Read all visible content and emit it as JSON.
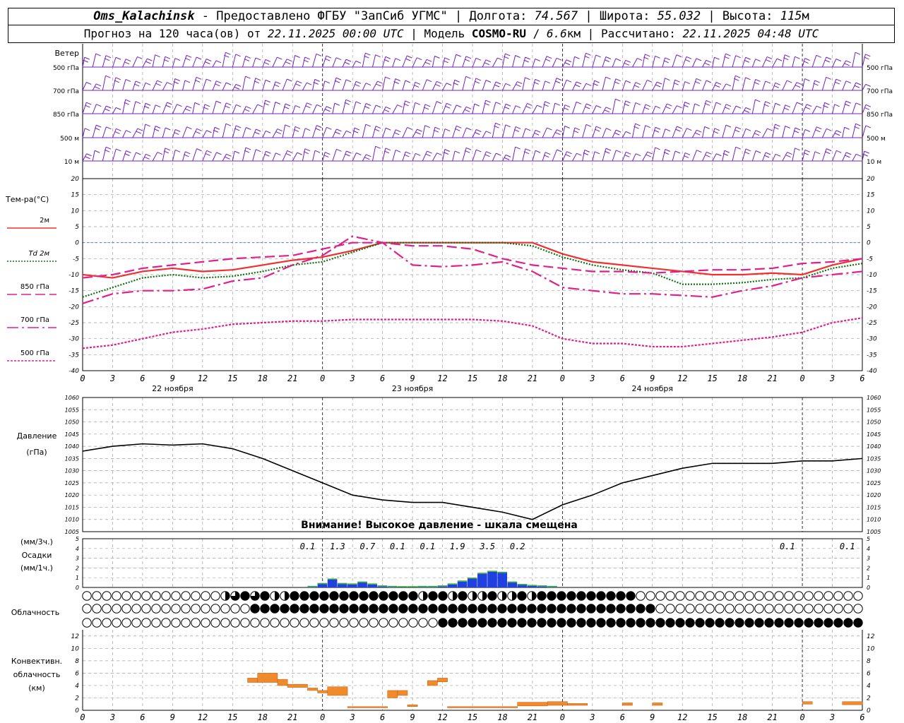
{
  "header": {
    "station": "Oms_Kalachinsk",
    "provider": "Предоставлено ФГБУ \"ЗапСиб УГМС\"",
    "lon_label": "Долгота:",
    "lon_value": "74.567",
    "lat_label": "Широта:",
    "lat_value": "55.032",
    "alt_label": "Высота:",
    "alt_value": "115",
    "alt_unit": "м",
    "forecast_prefix": "Прогноз на 120 часа(ов) от",
    "forecast_start": "22.11.2025 00:00 UTC",
    "model_label": "Модель",
    "model_name": "COSMO-RU",
    "model_res": "6.6",
    "model_unit": "км",
    "calc_label": "Рассчитано:",
    "calc_time": "22.11.2025 04:48 UTC"
  },
  "chart_data": {
    "x_ticks": [
      "0",
      "3",
      "6",
      "9",
      "12",
      "15",
      "18",
      "21",
      "0",
      "3",
      "6",
      "9",
      "12",
      "15",
      "18",
      "21",
      "0",
      "3",
      "6",
      "9",
      "12",
      "15",
      "18",
      "21",
      "0",
      "3",
      "6"
    ],
    "day_labels": [
      "22 ноября",
      "23 ноября",
      "24 ноября"
    ],
    "wind": {
      "title": "Ветер",
      "levels": [
        "500 гПа",
        "700 гПа",
        "850 гПа",
        "500 м",
        "10  м"
      ],
      "color": "#7020c0"
    },
    "temperature": {
      "type": "line",
      "title": "Тем-ра(°C)",
      "ylim": [
        -40,
        20
      ],
      "yticks": [
        20,
        15,
        10,
        5,
        0,
        -5,
        -10,
        -15,
        -20,
        -25,
        -30,
        -35,
        -40
      ],
      "series": [
        {
          "name": "2м",
          "color": "#f03030",
          "style": "solid",
          "x": [
            0,
            3,
            6,
            9,
            12,
            15,
            18,
            21,
            24,
            27,
            30,
            33,
            36,
            39,
            42,
            45,
            48,
            51,
            54,
            57,
            60,
            63,
            66,
            69,
            72,
            75,
            78
          ],
          "values": [
            -10,
            -11,
            -9,
            -8,
            -9,
            -8.5,
            -7,
            -5.5,
            -4.5,
            -2.5,
            0,
            0,
            0,
            0,
            0,
            0,
            -3.5,
            -6,
            -7,
            -8,
            -9,
            -10,
            -10,
            -9.5,
            -10,
            -7,
            -5
          ]
        },
        {
          "name": "Td  2м",
          "color": "#107010",
          "style": "dotted",
          "x": [
            0,
            3,
            6,
            9,
            12,
            15,
            18,
            21,
            24,
            27,
            30,
            33,
            36,
            39,
            42,
            45,
            48,
            51,
            54,
            57,
            60,
            63,
            66,
            69,
            72,
            75,
            78
          ],
          "values": [
            -17,
            -14,
            -11,
            -10,
            -11,
            -10.5,
            -9,
            -7,
            -6,
            -3,
            0,
            0,
            0,
            0,
            0,
            -1,
            -4.5,
            -7,
            -8.5,
            -9.5,
            -13,
            -13,
            -12.5,
            -11.5,
            -11,
            -8,
            -6.5
          ]
        },
        {
          "name": "850 гПа",
          "color": "#e0208a",
          "style": "dashed",
          "x": [
            0,
            3,
            6,
            9,
            12,
            15,
            18,
            21,
            24,
            27,
            30,
            33,
            36,
            39,
            42,
            45,
            48,
            51,
            54,
            57,
            60,
            63,
            66,
            69,
            72,
            75,
            78
          ],
          "values": [
            -11,
            -10,
            -8,
            -7,
            -6,
            -5,
            -4.5,
            -4,
            -2,
            0,
            0,
            -1,
            -1,
            -2,
            -5,
            -7,
            -8,
            -9,
            -9,
            -9.5,
            -9,
            -8.5,
            -8.5,
            -8,
            -6.5,
            -6,
            -5
          ]
        },
        {
          "name": "700 гПа",
          "color": "#e0208a",
          "style": "dashdot",
          "x": [
            0,
            3,
            6,
            9,
            12,
            15,
            18,
            21,
            24,
            27,
            30,
            33,
            36,
            39,
            42,
            45,
            48,
            51,
            54,
            57,
            60,
            63,
            66,
            69,
            72,
            75,
            78
          ],
          "values": [
            -19,
            -16,
            -15,
            -15,
            -14.5,
            -12,
            -11,
            -7,
            -4,
            2,
            0,
            -7,
            -7.5,
            -7,
            -6,
            -9,
            -14,
            -15,
            -16,
            -16,
            -16.5,
            -17,
            -15,
            -13.5,
            -11,
            -10,
            -9
          ]
        },
        {
          "name": "500 гПа",
          "color": "#e0208a",
          "style": "densedot",
          "x": [
            0,
            3,
            6,
            9,
            12,
            15,
            18,
            21,
            24,
            27,
            30,
            33,
            36,
            39,
            42,
            45,
            48,
            51,
            54,
            57,
            60,
            63,
            66,
            69,
            72,
            75,
            78
          ],
          "values": [
            -33,
            -32,
            -30,
            -28,
            -27,
            -25.5,
            -25,
            -24.5,
            -24.5,
            -24,
            -24,
            -24,
            -24,
            -24,
            -24.5,
            -26,
            -30,
            -31.5,
            -31.5,
            -32.5,
            -32.5,
            -31.5,
            -30.5,
            -29.5,
            -28,
            -25,
            -23.5
          ]
        }
      ]
    },
    "pressure": {
      "type": "line",
      "title": "Давление",
      "unit": "(гПа)",
      "ylim": [
        1005,
        1060
      ],
      "yticks": [
        1060,
        1055,
        1050,
        1045,
        1040,
        1035,
        1030,
        1025,
        1020,
        1015,
        1010,
        1005
      ],
      "warning": "Внимание! Высокое давление - шкала смещена",
      "x": [
        0,
        3,
        6,
        9,
        12,
        15,
        18,
        21,
        24,
        27,
        30,
        33,
        36,
        39,
        42,
        45,
        48,
        51,
        54,
        57,
        60,
        63,
        66,
        69,
        72,
        75,
        78
      ],
      "values": [
        1038,
        1040,
        1041,
        1040.5,
        1041,
        1039,
        1035,
        1030,
        1025,
        1020,
        1018,
        1017,
        1017,
        1015,
        1013,
        1010,
        1016,
        1020,
        1025,
        1028,
        1031,
        1033,
        1033,
        1033,
        1034,
        1034,
        1035
      ]
    },
    "precip": {
      "type": "bar",
      "title": "Осадки",
      "unit_3h": "(мм/3ч.)",
      "unit_1h": "(мм/1ч.)",
      "ylim": [
        0,
        5
      ],
      "yticks": [
        5,
        4,
        3,
        2,
        1,
        0
      ],
      "totals": [
        {
          "x": 22.5,
          "label": "0.1"
        },
        {
          "x": 25.5,
          "label": "1.3"
        },
        {
          "x": 28.5,
          "label": "0.7"
        },
        {
          "x": 31.5,
          "label": "0.1"
        },
        {
          "x": 34.5,
          "label": "0.1"
        },
        {
          "x": 37.5,
          "label": "1.9"
        },
        {
          "x": 40.5,
          "label": "3.5"
        },
        {
          "x": 43.5,
          "label": "0.2"
        },
        {
          "x": 70.5,
          "label": "0.1"
        },
        {
          "x": 76.5,
          "label": "0.1"
        }
      ],
      "x": [
        23,
        24,
        25,
        26,
        27,
        28,
        29,
        30,
        31,
        32,
        33,
        34,
        35,
        36,
        37,
        38,
        39,
        40,
        41,
        42,
        43,
        44,
        45,
        46,
        47
      ],
      "values": [
        0.05,
        0.35,
        0.8,
        0.35,
        0.3,
        0.5,
        0.3,
        0.1,
        0.05,
        0.02,
        0.02,
        0.05,
        0.05,
        0.1,
        0.3,
        0.6,
        0.9,
        1.4,
        1.6,
        1.5,
        0.5,
        0.25,
        0.15,
        0.1,
        0.05
      ]
    },
    "cloud": {
      "title": "Облачность",
      "rows": [
        "0000000000000036262332222222222222322323323323222222222200000000000000000000000000000000000000000000000000000001001000003",
        "0000000000000000022222222222222222222222222222222222222222000000000000000000000000000000000000000000010000000000000001000003",
        "0000000000000000000000000000000000002222222222222222222222222222222222222222222222222222222222221222200022000000002222222222"
      ]
    },
    "convective": {
      "type": "bar",
      "title_1": "Конвективн.",
      "title_2": "облачность",
      "unit": "(км)",
      "ylim": [
        0,
        13
      ],
      "yticks": [
        12,
        10,
        8,
        6,
        4,
        2,
        0
      ],
      "bars": [
        {
          "x0": 16.5,
          "x1": 17.5,
          "bottom": 4.5,
          "top": 5.2
        },
        {
          "x0": 17.5,
          "x1": 19.5,
          "bottom": 4.5,
          "top": 6.0
        },
        {
          "x0": 19.5,
          "x1": 20.5,
          "bottom": 4.0,
          "top": 5.0
        },
        {
          "x0": 20.5,
          "x1": 22.5,
          "bottom": 3.7,
          "top": 4.2
        },
        {
          "x0": 22.5,
          "x1": 23.5,
          "bottom": 3.2,
          "top": 3.6
        },
        {
          "x0": 23.5,
          "x1": 24.5,
          "bottom": 2.8,
          "top": 3.2
        },
        {
          "x0": 24.5,
          "x1": 26.5,
          "bottom": 2.4,
          "top": 3.8
        },
        {
          "x0": 26.5,
          "x1": 30.5,
          "bottom": 0.4,
          "top": 0.6
        },
        {
          "x0": 30.5,
          "x1": 31.5,
          "bottom": 2.0,
          "top": 3.2
        },
        {
          "x0": 31.5,
          "x1": 32.5,
          "bottom": 2.4,
          "top": 3.2
        },
        {
          "x0": 32.5,
          "x1": 33.5,
          "bottom": 0.6,
          "top": 0.9
        },
        {
          "x0": 34.5,
          "x1": 35.5,
          "bottom": 4.0,
          "top": 4.8
        },
        {
          "x0": 35.5,
          "x1": 36.5,
          "bottom": 4.6,
          "top": 5.2
        },
        {
          "x0": 36.5,
          "x1": 43.5,
          "bottom": 0.4,
          "top": 0.6
        },
        {
          "x0": 43.5,
          "x1": 46.5,
          "bottom": 0.7,
          "top": 1.3
        },
        {
          "x0": 46.5,
          "x1": 48.5,
          "bottom": 0.8,
          "top": 1.4
        },
        {
          "x0": 48.5,
          "x1": 50.5,
          "bottom": 0.8,
          "top": 1.1
        },
        {
          "x0": 54,
          "x1": 55,
          "bottom": 0.8,
          "top": 1.2
        },
        {
          "x0": 57,
          "x1": 58,
          "bottom": 0.8,
          "top": 1.2
        },
        {
          "x0": 72,
          "x1": 73,
          "bottom": 1.0,
          "top": 1.4
        },
        {
          "x0": 76,
          "x1": 78,
          "bottom": 0.9,
          "top": 1.4
        }
      ],
      "color": "#f08a2a"
    }
  }
}
